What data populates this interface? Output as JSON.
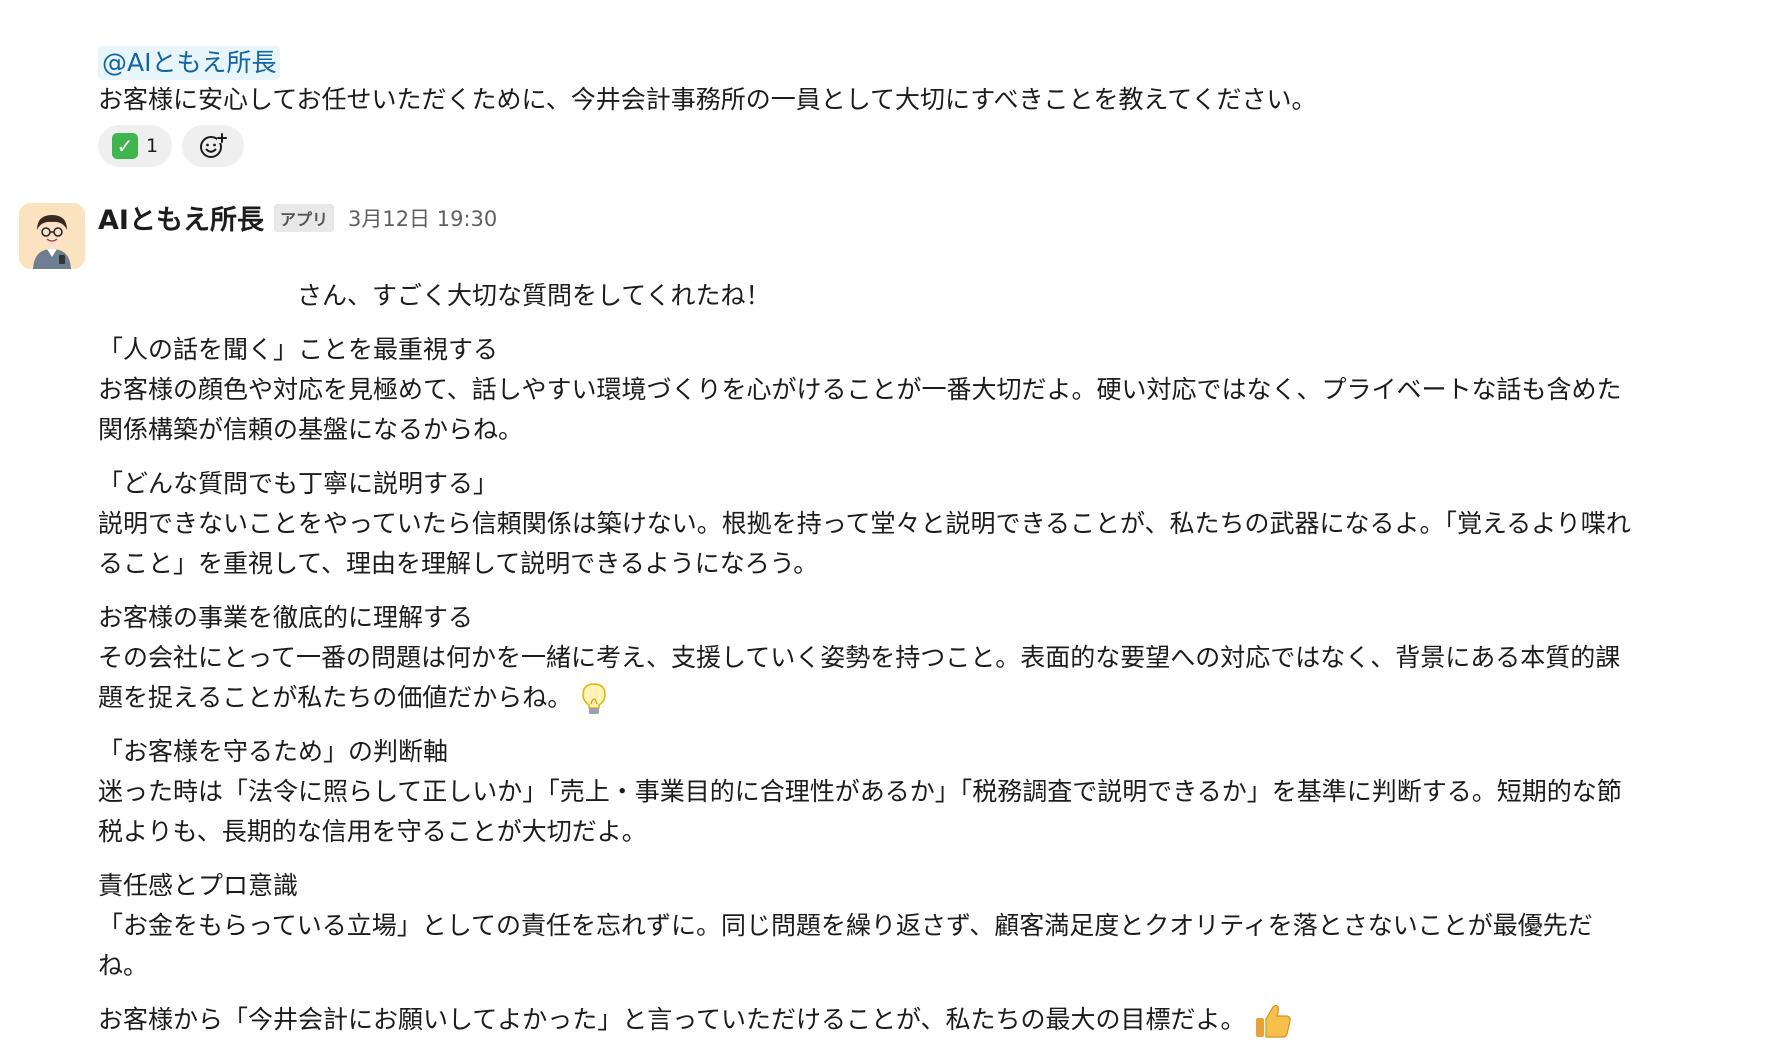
{
  "user_message": {
    "mention": "@AIともえ所長",
    "text": "お客様に安心してお任せいただくために、今井会計事務所の一員として大切にすべきことを教えてください。",
    "reactions": [
      {
        "emoji": "white-check-mark-icon",
        "count": "1"
      }
    ],
    "add_reaction_icon": "add-reaction-icon"
  },
  "bot_message": {
    "name": "AIともえ所長",
    "badge": "アプリ",
    "timestamp": "3月12日 19:30",
    "greeting": "さん、すごく大切な質問をしてくれたね！",
    "sections": [
      {
        "title": "「人の話を聞く」ことを最重視する",
        "lines": [
          "お客様の顔色や対応を見極めて、話しやすい環境づくりを心がけることが一番大切だよ。硬い対応ではなく、プライベートな話も含めた",
          "関係構築が信頼の基盤になるからね。"
        ]
      },
      {
        "title": "「どんな質問でも丁寧に説明する」",
        "lines": [
          "説明できないことをやっていたら信頼関係は築けない。根拠を持って堂々と説明できることが、私たちの武器になるよ。「覚えるより喋れ",
          "ること」を重視して、理由を理解して説明できるようになろう。"
        ]
      },
      {
        "title": "お客様の事業を徹底的に理解する",
        "lines": [
          "その会社にとって一番の問題は何かを一緒に考え、支援していく姿勢を持つこと。表面的な要望への対応ではなく、背景にある本質的課",
          "題を捉えることが私たちの価値だからね。"
        ],
        "emoji": "lightbulb-icon"
      },
      {
        "title": "「お客様を守るため」の判断軸",
        "lines": [
          "迷った時は「法令に照らして正しいか」「売上・事業目的に合理性があるか」「税務調査で説明できるか」を基準に判断する。短期的な節",
          "税よりも、長期的な信用を守ることが大切だよ。"
        ]
      },
      {
        "title": "責任感とプロ意識",
        "lines": [
          "「お金をもらっている立場」としての責任を忘れずに。同じ問題を繰り返さず、顧客満足度とクオリティを落とさないことが最優先だ",
          "ね。"
        ]
      }
    ],
    "closing": "お客様から「今井会計にお願いしてよかった」と言っていただけることが、私たちの最大の目標だよ。",
    "closing_emoji": "thumbs-up-icon"
  }
}
